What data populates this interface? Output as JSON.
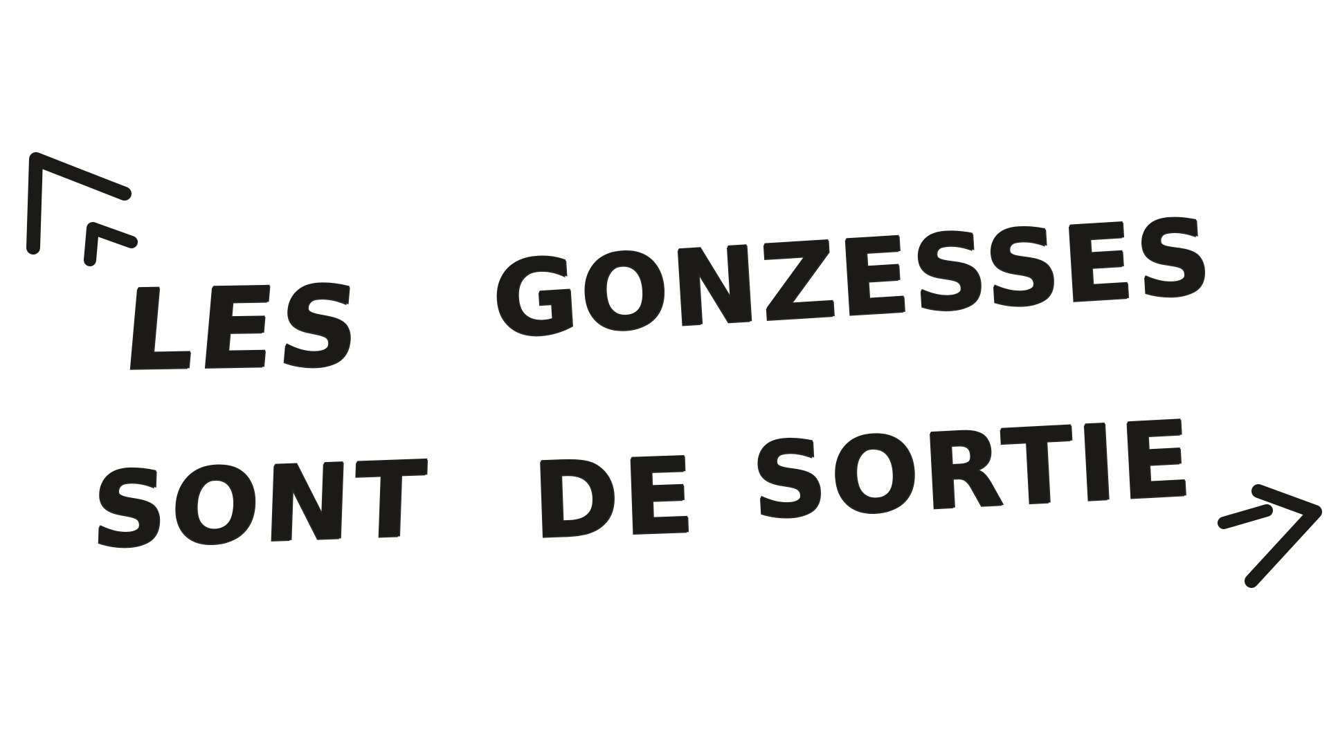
{
  "title": {
    "line1": [
      "LES",
      "GONZESSES"
    ],
    "line2": [
      "SONT",
      "DE",
      "SORTIE"
    ]
  },
  "quotes": {
    "open": "«",
    "close": "»"
  },
  "colors": {
    "ink": "#1c1a17",
    "paper": "#ffffff"
  }
}
